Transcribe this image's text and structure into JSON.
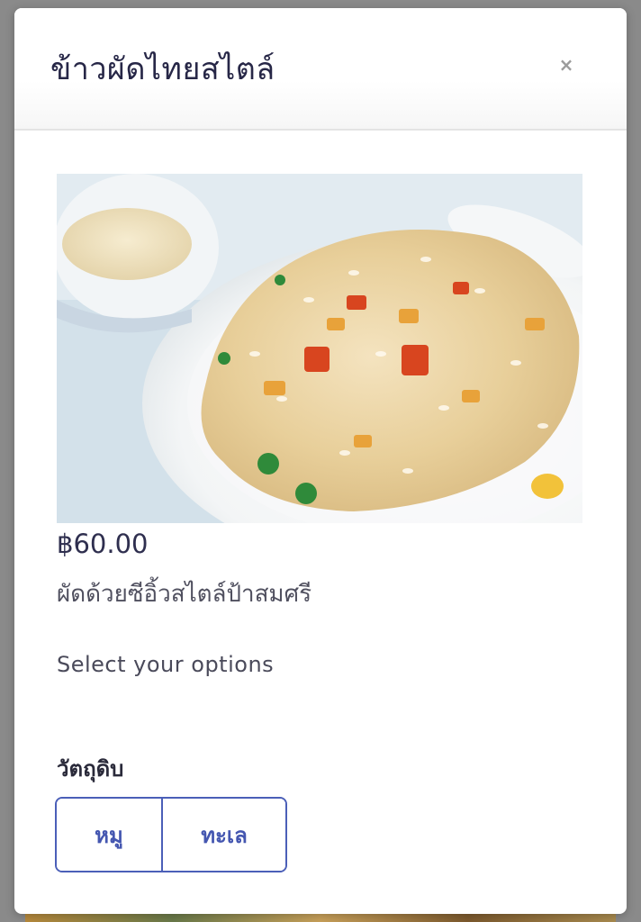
{
  "modal": {
    "title": "ข้าวผัดไทยสไตล์",
    "close_glyph": "×"
  },
  "item": {
    "price": "฿60.00",
    "description": "ผัดด้วยซีอิ้วสไตล์ป้าสมศรี",
    "image_icon": "fried-rice-photo"
  },
  "options": {
    "prompt": "Select your options",
    "groups": [
      {
        "label": "วัตถุดิบ",
        "choices": [
          "หมู",
          "ทะเล"
        ]
      }
    ]
  },
  "colors": {
    "accent": "#4b5fb8",
    "title": "#272747"
  }
}
